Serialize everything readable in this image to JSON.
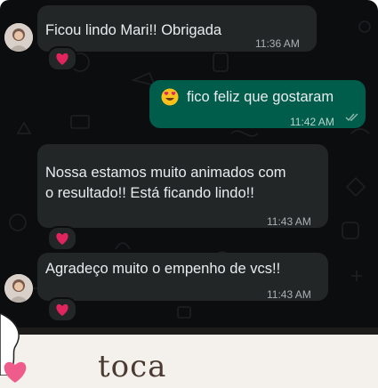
{
  "messages": [
    {
      "direction": "incoming",
      "text": "Ficou lindo Mari!! Obrigada",
      "time": "11:36 AM",
      "reaction": "heart"
    },
    {
      "direction": "outgoing",
      "emoji": "smiling-face-with-heart-eyes",
      "text": "fico feliz que gostaram",
      "time": "11:42 AM",
      "status": "read"
    },
    {
      "direction": "incoming",
      "lines": [
        "Nossa estamos muito animados com",
        "o resultado!! Está ficando lindo!!"
      ],
      "time": "11:43 AM",
      "reaction": "heart"
    },
    {
      "direction": "incoming",
      "text": "Agradeço muito o empenho de vcs!!",
      "time": "11:43 AM",
      "reaction": "heart"
    }
  ],
  "footer": {
    "brand_text": "toca",
    "icon": "heart-icon"
  },
  "colors": {
    "chat_bg": "#0b0d0e",
    "incoming_bubble": "#232626",
    "outgoing_bubble": "#005c4b",
    "read_ticks": "#53bdeb",
    "reaction_heart": "#e0245e"
  }
}
